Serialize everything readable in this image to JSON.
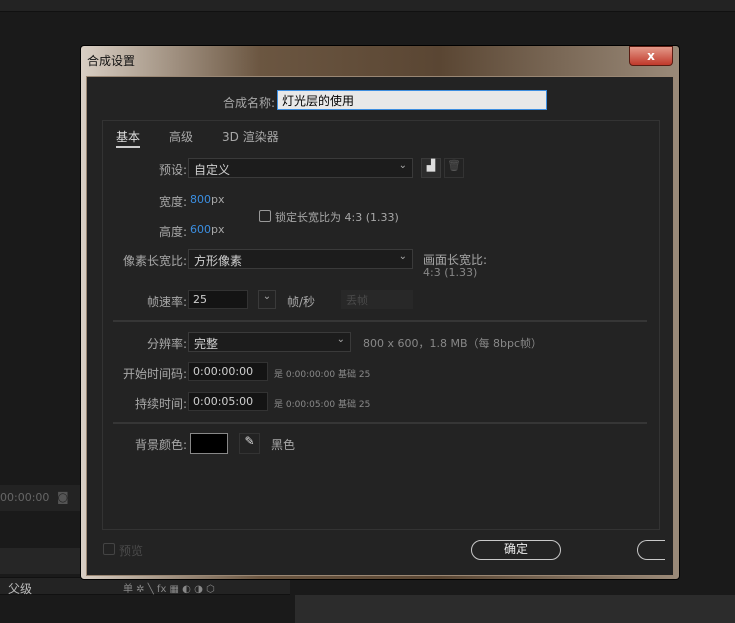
{
  "background": {
    "timecode": "00:00:00",
    "parent_label": "父级",
    "layer_switches": "单 ✲ ╲ fx ▦ ◐ ◑ ⬡"
  },
  "dialog": {
    "title": "合成设置",
    "close_label": "x",
    "name_label": "合成名称:",
    "name_value": "灯光层的使用",
    "tabs": [
      "基本",
      "高级",
      "3D 渲染器"
    ],
    "preset": {
      "label": "预设:",
      "value": "自定义"
    },
    "width": {
      "label": "宽度:",
      "value": "800",
      "unit": "px"
    },
    "height": {
      "label": "高度:",
      "value": "600",
      "unit": "px"
    },
    "lock_aspect": {
      "label": "锁定长宽比为 4:3 (1.33)",
      "checked": false
    },
    "pixel_aspect": {
      "label": "像素长宽比:",
      "value": "方形像素"
    },
    "frame_aspect": {
      "label": "画面长宽比:",
      "value": "4:3 (1.33)"
    },
    "frame_rate": {
      "label": "帧速率:",
      "value": "25",
      "unit": "帧/秒",
      "drop": "丢帧"
    },
    "resolution": {
      "label": "分辨率:",
      "value": "完整",
      "info": "800 x 600，1.8 MB（每 8bpc帧）"
    },
    "start_timecode": {
      "label": "开始时间码:",
      "value": "0:00:00:00",
      "info": "是 0:00:00:00",
      "base": "基础 25"
    },
    "duration": {
      "label": "持续时间:",
      "value": "0:00:05:00",
      "info": "是 0:00:05:00",
      "base": "基础 25"
    },
    "bg_color": {
      "label": "背景颜色:",
      "name": "黑色",
      "color": "#000000"
    },
    "preview_label": "预览",
    "ok_label": "确定"
  }
}
